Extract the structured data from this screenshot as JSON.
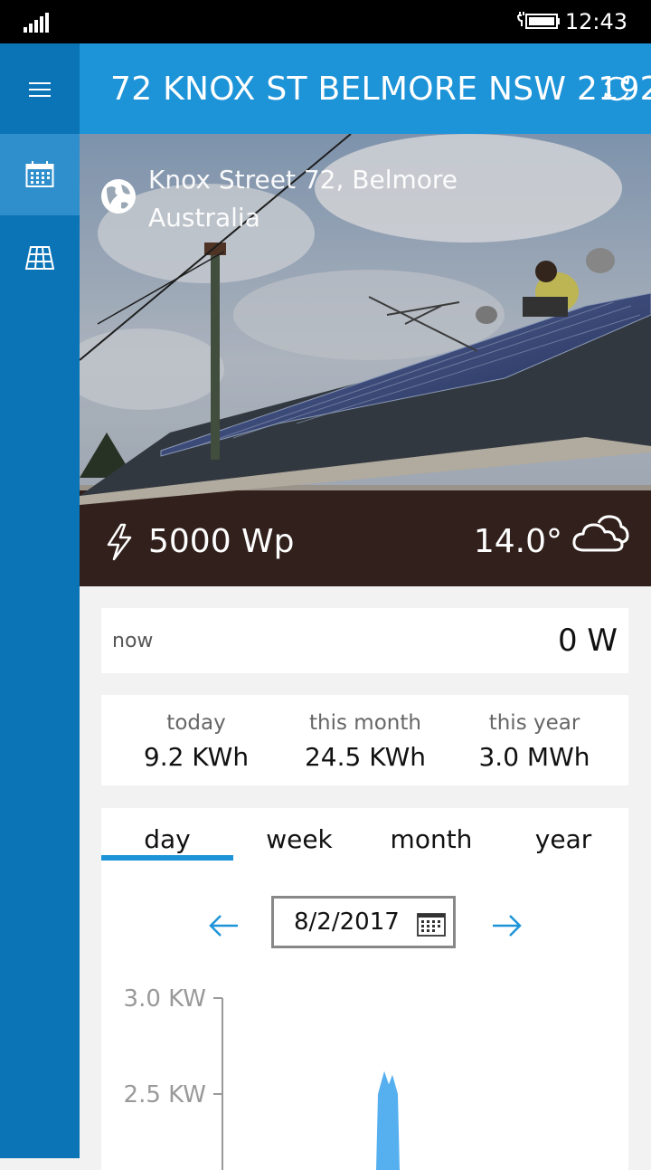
{
  "status_bar": {
    "time": "12:43"
  },
  "header": {
    "title": "72 KNOX ST BELMORE NSW 2192"
  },
  "sidebar": {
    "items": [
      {
        "icon": "hamburger-menu-icon"
      },
      {
        "icon": "calendar-icon",
        "active": true
      },
      {
        "icon": "solar-panel-icon"
      }
    ]
  },
  "hero": {
    "address_line1": "Knox Street 72, Belmore",
    "address_line2": "Australia",
    "system_size": "5000 Wp",
    "temperature": "14.0°",
    "weather_icon": "cloudy-icon"
  },
  "now": {
    "label": "now",
    "value": "0 W"
  },
  "stats": [
    {
      "label": "today",
      "value": "9.2 KWh"
    },
    {
      "label": "this month",
      "value": "24.5 KWh"
    },
    {
      "label": "this year",
      "value": "3.0 MWh"
    }
  ],
  "tabs": [
    "day",
    "week",
    "month",
    "year"
  ],
  "active_tab": "day",
  "date_picker": {
    "value": "8/2/2017"
  },
  "colors": {
    "accent": "#1e94d8",
    "sidebar": "#0a74b6",
    "chart": "#56b0ef"
  },
  "chart_data": {
    "type": "area",
    "y_ticks": [
      "3.0 KW",
      "2.5 KW"
    ],
    "series": [
      {
        "values_kw": [
          0,
          2.5,
          2.62,
          2.55,
          2.6,
          2.5,
          0
        ]
      }
    ]
  }
}
